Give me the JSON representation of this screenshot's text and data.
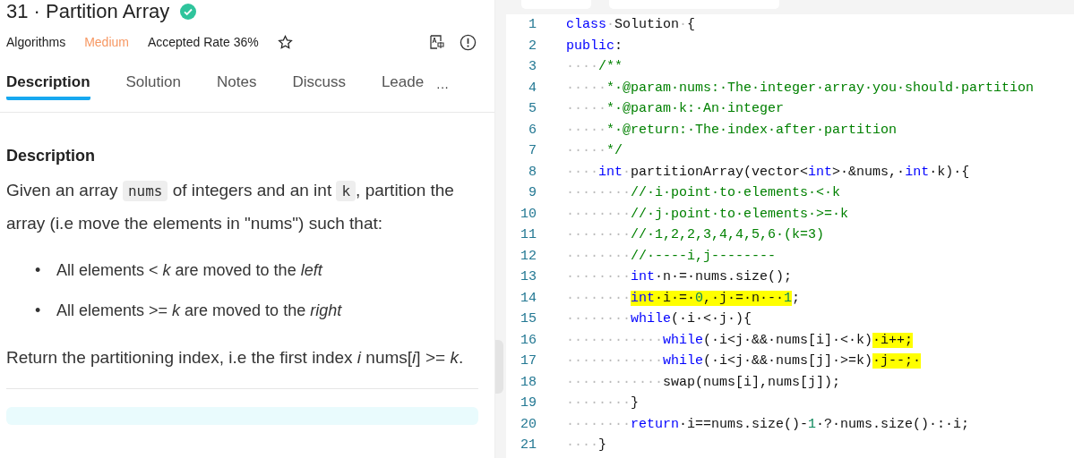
{
  "problem": {
    "title": "31 · Partition Array",
    "solved": true,
    "category": "Algorithms",
    "difficulty": "Medium",
    "accepted_rate": "Accepted Rate 36%",
    "starred": false
  },
  "tabs": [
    {
      "label": "Description",
      "selected": true
    },
    {
      "label": "Solution",
      "selected": false
    },
    {
      "label": "Notes",
      "selected": false
    },
    {
      "label": "Discuss",
      "selected": false
    },
    {
      "label": "Leade",
      "selected": false
    }
  ],
  "more_button": "···",
  "description": {
    "heading": "Description",
    "intro": [
      {
        "kind": "text",
        "text": "Given an array "
      },
      {
        "kind": "code",
        "text": "nums"
      },
      {
        "kind": "text",
        "text": " of integers and an int "
      },
      {
        "kind": "code",
        "text": "k"
      },
      {
        "kind": "text",
        "text": ", partition the array (i.e move the elements in \"nums\") such that:"
      }
    ],
    "bullets": [
      {
        "marker": "•",
        "text": "All elements < *k* are moved to the *left*"
      },
      {
        "marker": "•",
        "text": "All elements >= *k* are moved to the *right*"
      }
    ],
    "outro": "Return the partitioning index, i.e the first index *i* nums[*i*] >= *k*."
  },
  "code_lines": [
    {
      "number": "1",
      "tokens": [
        {
          "kind": "keyword",
          "text": "class"
        },
        {
          "kind": "ws",
          "text": "·"
        },
        {
          "kind": "plain",
          "text": "Solution"
        },
        {
          "kind": "ws",
          "text": "·"
        },
        {
          "kind": "plain",
          "text": "{"
        }
      ]
    },
    {
      "number": "2",
      "tokens": [
        {
          "kind": "keyword",
          "text": "public"
        },
        {
          "kind": "plain",
          "text": ":"
        }
      ]
    },
    {
      "number": "3",
      "tokens": [
        {
          "kind": "ws",
          "text": "····"
        },
        {
          "kind": "comment",
          "text": "/**"
        }
      ]
    },
    {
      "number": "4",
      "tokens": [
        {
          "kind": "ws",
          "text": "·····"
        },
        {
          "kind": "comment",
          "text": "*·@param·nums:·The·integer·array·you·should·partition"
        }
      ]
    },
    {
      "number": "5",
      "tokens": [
        {
          "kind": "ws",
          "text": "·····"
        },
        {
          "kind": "comment",
          "text": "*·@param·k:·An·integer"
        }
      ]
    },
    {
      "number": "6",
      "tokens": [
        {
          "kind": "ws",
          "text": "·····"
        },
        {
          "kind": "comment",
          "text": "*·@return:·The·index·after·partition"
        }
      ]
    },
    {
      "number": "7",
      "tokens": [
        {
          "kind": "ws",
          "text": "·····"
        },
        {
          "kind": "comment",
          "text": "*/"
        }
      ]
    },
    {
      "number": "8",
      "tokens": [
        {
          "kind": "ws",
          "text": "····"
        },
        {
          "kind": "keyword",
          "text": "int"
        },
        {
          "kind": "ws",
          "text": "·"
        },
        {
          "kind": "plain",
          "text": "partitionArray(vector<"
        },
        {
          "kind": "keyword",
          "text": "int"
        },
        {
          "kind": "plain",
          "text": ">·&nums,·"
        },
        {
          "kind": "keyword",
          "text": "int"
        },
        {
          "kind": "plain",
          "text": "·k)·{"
        }
      ]
    },
    {
      "number": "9",
      "tokens": [
        {
          "kind": "ws",
          "text": "········"
        },
        {
          "kind": "comment",
          "text": "//·i·point·to·elements·<·k"
        }
      ]
    },
    {
      "number": "10",
      "tokens": [
        {
          "kind": "ws",
          "text": "········"
        },
        {
          "kind": "comment",
          "text": "//·j·point·to·elements·>=·k"
        }
      ]
    },
    {
      "number": "11",
      "tokens": [
        {
          "kind": "ws",
          "text": "········"
        },
        {
          "kind": "comment",
          "text": "//·1,2,2,3,4,4,5,6·(k=3)"
        }
      ]
    },
    {
      "number": "12",
      "tokens": [
        {
          "kind": "ws",
          "text": "········"
        },
        {
          "kind": "comment",
          "text": "//·----i,j--------"
        }
      ]
    },
    {
      "number": "13",
      "tokens": [
        {
          "kind": "ws",
          "text": "········"
        },
        {
          "kind": "keyword",
          "text": "int"
        },
        {
          "kind": "plain",
          "text": "·n·=·nums.size();"
        }
      ]
    },
    {
      "number": "14",
      "tokens": [
        {
          "kind": "ws",
          "text": "········"
        },
        {
          "kind": "keyword",
          "text": "int",
          "highlighted": true
        },
        {
          "kind": "plain",
          "text": "·i·=·",
          "highlighted": true
        },
        {
          "kind": "number",
          "text": "0",
          "highlighted": true
        },
        {
          "kind": "plain",
          "text": ",·j·=·n·-·",
          "highlighted": true
        },
        {
          "kind": "number",
          "text": "1",
          "highlighted": true
        },
        {
          "kind": "plain",
          "text": ";"
        }
      ]
    },
    {
      "number": "15",
      "tokens": [
        {
          "kind": "ws",
          "text": "········"
        },
        {
          "kind": "keyword",
          "text": "while"
        },
        {
          "kind": "plain",
          "text": "(·i·<·j·){"
        }
      ]
    },
    {
      "number": "16",
      "tokens": [
        {
          "kind": "ws",
          "text": "············"
        },
        {
          "kind": "keyword",
          "text": "while"
        },
        {
          "kind": "plain",
          "text": "(·i<j·&&·nums[i]·<·k)"
        },
        {
          "kind": "plain",
          "text": "·i++;",
          "highlighted": true
        }
      ]
    },
    {
      "number": "17",
      "tokens": [
        {
          "kind": "ws",
          "text": "············"
        },
        {
          "kind": "keyword",
          "text": "while"
        },
        {
          "kind": "plain",
          "text": "(·i<j·&&·nums[j]·>=k)"
        },
        {
          "kind": "plain",
          "text": "·j--;·",
          "highlighted": true
        }
      ]
    },
    {
      "number": "18",
      "tokens": [
        {
          "kind": "ws",
          "text": "············"
        },
        {
          "kind": "plain",
          "text": "swap(nums[i],nums[j]);"
        }
      ]
    },
    {
      "number": "19",
      "tokens": [
        {
          "kind": "ws",
          "text": "········"
        },
        {
          "kind": "plain",
          "text": "}"
        }
      ]
    },
    {
      "number": "20",
      "tokens": [
        {
          "kind": "ws",
          "text": "········"
        },
        {
          "kind": "keyword",
          "text": "return"
        },
        {
          "kind": "plain",
          "text": "·i==nums.size()-"
        },
        {
          "kind": "number",
          "text": "1"
        },
        {
          "kind": "plain",
          "text": "·?·nums.size()·:·i;"
        }
      ]
    },
    {
      "number": "21",
      "tokens": [
        {
          "kind": "ws",
          "text": "····"
        },
        {
          "kind": "plain",
          "text": "}"
        }
      ]
    }
  ]
}
